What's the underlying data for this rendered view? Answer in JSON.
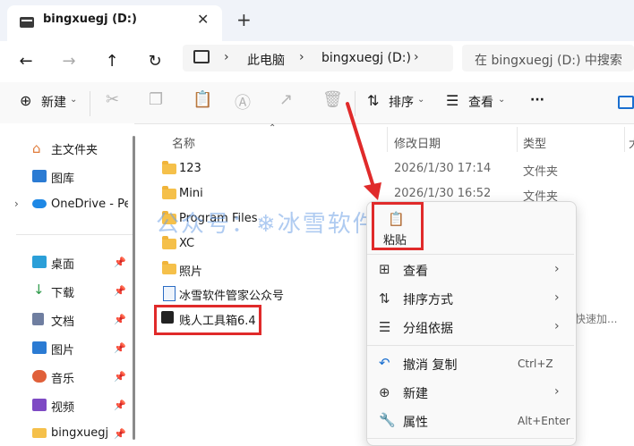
{
  "titlebar": {
    "tab_title": "bingxuegj (D:)",
    "close_glyph": "✕",
    "add_glyph": "+"
  },
  "nav": {
    "back": "←",
    "forward": "→",
    "up": "↑",
    "refresh": "↻",
    "breadcrumb": [
      "此电脑",
      "bingxuegj (D:)"
    ],
    "search_placeholder": "在 bingxuegj (D:) 中搜索"
  },
  "toolbar": {
    "new_label": "新建",
    "sort_label": "排序",
    "view_label": "查看",
    "more": "···"
  },
  "sidebar": {
    "items": [
      {
        "label": "主文件夹",
        "icon": "home-icon",
        "color": "#e07b39"
      },
      {
        "label": "图库",
        "icon": "gallery-icon",
        "color": "#2b7bd3"
      },
      {
        "label": "OneDrive - Per",
        "icon": "cloud-icon",
        "color": "#1e88e5"
      },
      {
        "label": "桌面",
        "icon": "desktop-icon",
        "color": "#2b9fd8"
      },
      {
        "label": "下载",
        "icon": "download-icon",
        "color": "#2e9a4a"
      },
      {
        "label": "文档",
        "icon": "document-icon",
        "color": "#6f7ea0"
      },
      {
        "label": "图片",
        "icon": "picture-icon",
        "color": "#2b7bd3"
      },
      {
        "label": "音乐",
        "icon": "music-icon",
        "color": "#e0603a"
      },
      {
        "label": "视频",
        "icon": "video-icon",
        "color": "#7e4ac4"
      },
      {
        "label": "bingxuegj",
        "icon": "folder-icon",
        "color": "#f5c04a"
      }
    ]
  },
  "columns": {
    "name": "名称",
    "modified": "修改日期",
    "type": "类型",
    "extra": "大"
  },
  "files": [
    {
      "name": "123",
      "date": "2026/1/30 17:14",
      "type": "文件夹"
    },
    {
      "name": "Mini",
      "date": "2026/1/30 16:52",
      "type": "文件夹"
    },
    {
      "name": "Program Files",
      "date": "",
      "type": ""
    },
    {
      "name": "XC",
      "date": "",
      "type": ""
    },
    {
      "name": "照片",
      "date": "",
      "type": ""
    },
    {
      "name": "冰雪软件管家公众号",
      "date": "",
      "type": ""
    },
    {
      "name": "贱人工具箱6.4",
      "date": "",
      "type": ""
    }
  ],
  "truncated_text": "快速加...",
  "context_menu": {
    "paste": "粘贴",
    "view": "查看",
    "sort": "排序方式",
    "group": "分组依据",
    "undo": "撤消 复制",
    "undo_shortcut": "Ctrl+Z",
    "new": "新建",
    "properties": "属性",
    "properties_shortcut": "Alt+Enter"
  },
  "watermark": "公众号：❄冰雪软件库",
  "colors": {
    "annotation_red": "#e02a2a",
    "folder": "#f5c04a"
  }
}
